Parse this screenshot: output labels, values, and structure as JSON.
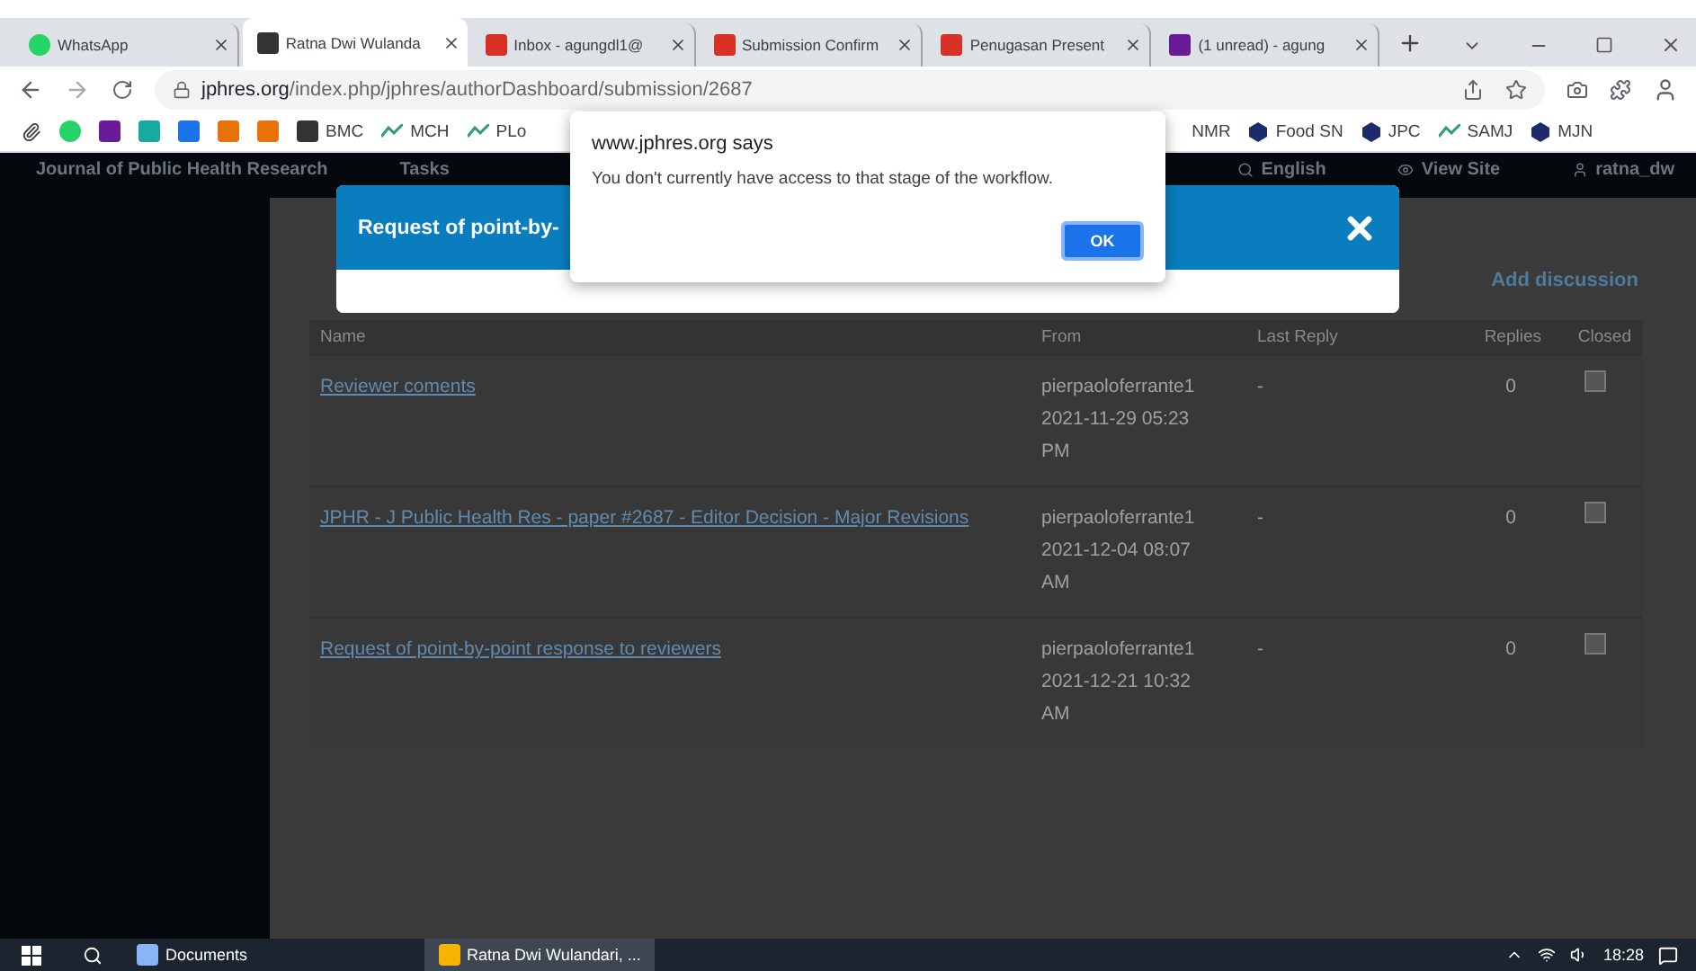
{
  "browser": {
    "tabs": [
      {
        "label": "WhatsApp",
        "selected": false
      },
      {
        "label": "Ratna Dwi Wulanda",
        "selected": true
      },
      {
        "label": "Inbox - agungdl1@",
        "selected": false
      },
      {
        "label": "Submission Confirm",
        "selected": false
      },
      {
        "label": "Penugasan Present",
        "selected": false
      },
      {
        "label": "(1 unread) - agung",
        "selected": false
      }
    ],
    "address": {
      "host": "jphres.org",
      "path": "/index.php/jphres/authorDashboard/submission/2687"
    },
    "bookmarks_left": [
      "BMC",
      "MCH",
      "PLo"
    ],
    "bookmarks_right": [
      "NMR",
      "Food SN",
      "JPC",
      "SAMJ",
      "MJN"
    ]
  },
  "site": {
    "header": {
      "title": "Journal of Public Health Research",
      "tasks": "Tasks",
      "language": "English",
      "view_site": "View Site",
      "user": "ratna_dw"
    },
    "discussions": {
      "add_label": "Add discussion",
      "columns": [
        "Name",
        "From",
        "Last Reply",
        "Replies",
        "Closed"
      ],
      "rows": [
        {
          "name": "Reviewer coments",
          "from": "pierpaoloferrante1",
          "date": "2021-11-29 05:23 PM",
          "last_reply": "-",
          "replies": "0",
          "closed": false
        },
        {
          "name": "JPHR - J Public Health Res - paper #2687 - Editor Decision - Major Revisions",
          "from": "pierpaoloferrante1",
          "date": "2021-12-04 08:07 AM",
          "last_reply": "-",
          "replies": "0",
          "closed": false
        },
        {
          "name": "Request of point-by-point response to reviewers",
          "from": "pierpaoloferrante1",
          "date": "2021-12-21 10:32 AM",
          "last_reply": "-",
          "replies": "0",
          "closed": false
        }
      ]
    }
  },
  "modal": {
    "title": "Request of point-by-"
  },
  "alert": {
    "origin": "www.jphres.org says",
    "message": "You don't currently have access to that stage of the workflow.",
    "button": "OK"
  },
  "taskbar": {
    "items": [
      {
        "label": "Documents",
        "active": false
      },
      {
        "label": "Ratna Dwi Wulandari, ...",
        "active": true
      }
    ],
    "time": "18:28"
  }
}
